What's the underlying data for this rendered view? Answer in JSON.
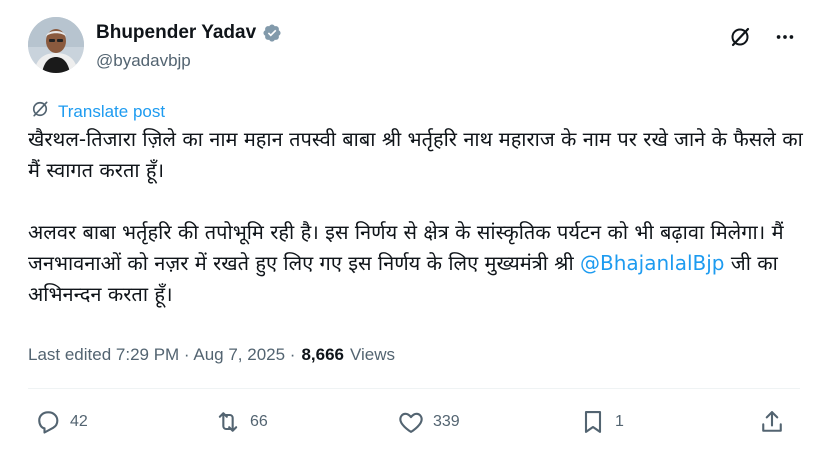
{
  "author": {
    "name": "Bhupender Yadav",
    "handle": "@byadavbjp",
    "verified_color": "#829aab"
  },
  "header_icons": [
    "grok-slash-icon",
    "more-icon"
  ],
  "translate": {
    "label": "Translate post"
  },
  "body": {
    "paragraph1": "खैरथल-तिजारा ज़िले का नाम महान तपस्वी बाबा श्री भर्तृहरि नाथ महाराज के नाम पर रखे जाने के फैसले का मैं स्वागत करता हूँ।",
    "paragraph2_start": "अलवर बाबा भर्तृहरि की तपोभूमि रही है। इस निर्णय से क्षेत्र के सांस्कृतिक पर्यटन को भी बढ़ावा मिलेगा। मैं जनभावनाओं को नज़र में रखते हुए लिए गए इस निर्णय के लिए मुख्यमंत्री श्री ",
    "mention": "@BhajanlalBjp",
    "paragraph2_end": " जी का अभिनन्दन करता हूँ।"
  },
  "meta": {
    "edited": "Last edited 7:29 PM · Aug 7, 2025 ·",
    "views_count": "8,666",
    "views_label": "Views"
  },
  "actions": {
    "replies": "42",
    "reposts": "66",
    "likes": "339",
    "bookmarks": "1"
  },
  "colors": {
    "accent": "#1d9bf0",
    "text": "#0f1419",
    "secondary": "#536471"
  }
}
